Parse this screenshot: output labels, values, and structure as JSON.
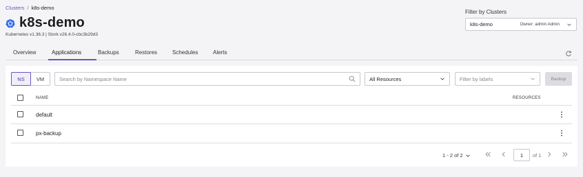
{
  "breadcrumb": {
    "parent": "Clusters",
    "separator": "/",
    "current": "k8s-demo"
  },
  "header": {
    "title": "k8s-demo",
    "version": "Kubernetes v1.36.3 | Stork v26.4.0-cbc3b29d3"
  },
  "cluster_filter": {
    "label": "Filter by Clusters",
    "selected": "k8s-demo",
    "owner": "Owner: admin Admin"
  },
  "tabs": [
    {
      "label": "Overview"
    },
    {
      "label": "Applications"
    },
    {
      "label": "Backups"
    },
    {
      "label": "Restores"
    },
    {
      "label": "Schedules"
    },
    {
      "label": "Alerts"
    }
  ],
  "active_tab": "Applications",
  "toolbar": {
    "ns_label": "NS",
    "vm_label": "VM",
    "search_placeholder": "Search by Namespace Name",
    "resources_value": "All Resources",
    "labels_placeholder": "Filter by labels",
    "backup_label": "Backup"
  },
  "table": {
    "columns": {
      "name": "NAME",
      "resources": "RESOURCES"
    },
    "rows": [
      {
        "name": "default",
        "resources": ""
      },
      {
        "name": "px-backup",
        "resources": ""
      }
    ]
  },
  "pagination": {
    "range": "1 - 2 of 2",
    "page": "1",
    "of_total": "of 1"
  },
  "colors": {
    "accent": "#6b52c4",
    "k8s_blue": "#326ce5"
  }
}
